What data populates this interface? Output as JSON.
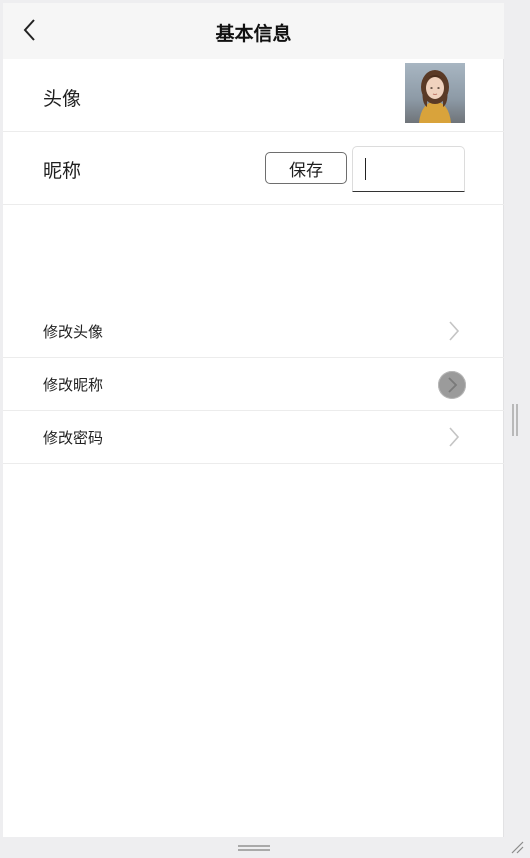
{
  "header": {
    "title": "基本信息",
    "back_icon": "chevron-left-icon"
  },
  "profile": {
    "avatar_label": "头像",
    "nickname_label": "昵称",
    "save_label": "保存",
    "nickname_value": ""
  },
  "menu": {
    "items": [
      {
        "label": "修改头像",
        "icon": "chevron-right-icon"
      },
      {
        "label": "修改昵称",
        "icon": "chevron-right-circle-icon"
      },
      {
        "label": "修改密码",
        "icon": "chevron-right-icon"
      }
    ]
  }
}
